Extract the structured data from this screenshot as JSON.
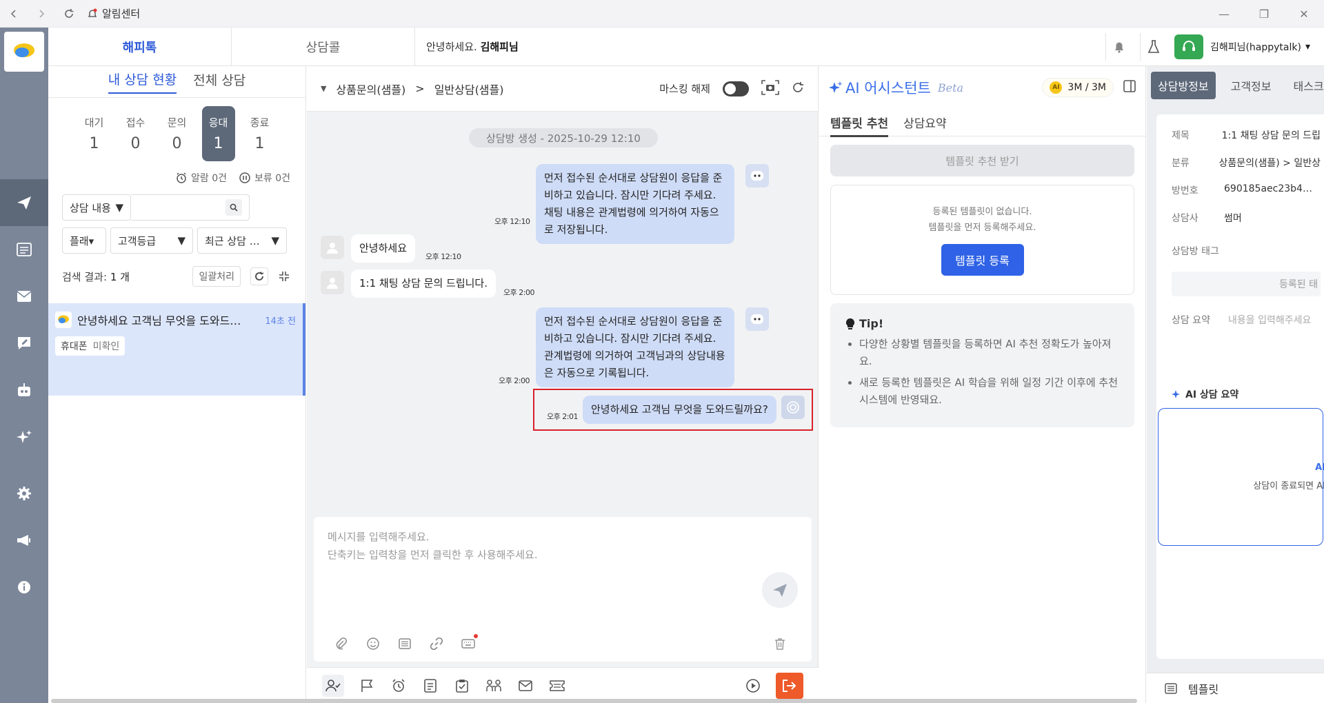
{
  "titlebar": {
    "title": "알림센터"
  },
  "header": {
    "tabs": [
      {
        "label": "해피톡",
        "active": true
      },
      {
        "label": "상담콜",
        "active": false
      }
    ],
    "greeting_prefix": "안녕하세요.",
    "greeting_name": "김해피님",
    "user": "김해피님(happytalk)"
  },
  "left": {
    "tabs": [
      {
        "label": "내 상담 현황",
        "active": true
      },
      {
        "label": "전체 상담",
        "active": false
      }
    ],
    "stats": [
      {
        "label": "대기",
        "value": "1"
      },
      {
        "label": "접수",
        "value": "0"
      },
      {
        "label": "문의",
        "value": "0"
      },
      {
        "label": "응대",
        "value": "1",
        "active": true
      },
      {
        "label": "종료",
        "value": "1"
      }
    ],
    "alarm": "알람 0건",
    "hold": "보류 0건",
    "filter": {
      "type": "상담 내용",
      "search_value": "",
      "platform": "플래▾",
      "grade": "고객등급",
      "sort": "최근 상담 …"
    },
    "result_prefix": "검색 결과:",
    "result_count": "1 개",
    "bulk": "일괄처리",
    "conversation": {
      "text": "안녕하세요 고객님 무엇을 도와드…",
      "time": "14초 전",
      "tag1": "휴대폰",
      "tag2": "미확인"
    }
  },
  "chat": {
    "breadcrumb": [
      "상품문의(샘플)",
      ">",
      "일반상담(샘플)"
    ],
    "masking": "마스킹 해제",
    "created": "상담방 생성 - 2025-10-29 12:10",
    "messages": [
      {
        "from": "agent",
        "text": "먼저 접수된 순서대로 상담원이 응답을 준비하고 있습니다. 잠시만 기다려 주세요. 채팅 내용은 관계법령에 의거하여 자동으로 저장됩니다.",
        "time": "오후 12:10"
      },
      {
        "from": "customer",
        "text": "안녕하세요",
        "time": "오후 12:10"
      },
      {
        "from": "customer",
        "text": "1:1 채팅 상담 문의 드립니다.",
        "time": "오후 2:00"
      },
      {
        "from": "agent",
        "text": "먼저 접수된 순서대로 상담원이 응답을 준비하고 있습니다. 잠시만 기다려 주세요. 관계법령에 의거하여 고객님과의 상담내용은 자동으로 기록됩니다.",
        "time": "오후 2:00"
      },
      {
        "from": "agent",
        "text": "안녕하세요 고객님 무엇을 도와드릴까요?",
        "time": "오후 2:01"
      }
    ],
    "composer_placeholder_1": "메시지를 입력해주세요.",
    "composer_placeholder_2": "단축키는 입력창을 먼저 클릭한 후 사용해주세요."
  },
  "ai": {
    "title": "AI 어시스턴트",
    "beta": "Beta",
    "quota": "3M / 3M",
    "tabs": [
      {
        "label": "템플릿 추천",
        "active": true
      },
      {
        "label": "상담요약",
        "active": false
      }
    ],
    "recommend_button": "템플릿 추천 받기",
    "empty_line1": "등록된 템플릿이 없습니다.",
    "empty_line2": "템플릿을 먼저 등록해주세요.",
    "register_button": "템플릿 등록",
    "tip_title": "Tip!",
    "tips": [
      "다양한 상황별 템플릿을 등록하면 AI 추천 정확도가 높아져요.",
      "새로 등록한 템플릿은 AI 학습을 위해 일정 기간 이후에 추천 시스템에 반영돼요."
    ]
  },
  "info": {
    "tabs": [
      {
        "label": "상담방정보",
        "active": true
      },
      {
        "label": "고객정보"
      },
      {
        "label": "태스크"
      }
    ],
    "rows": [
      {
        "k": "제목",
        "v": "1:1 채팅 상담 문의 드립"
      },
      {
        "k": "분류",
        "v": "상품문의(샘플) > 일반상"
      },
      {
        "k": "방번호",
        "v": "690185aec23b4…"
      },
      {
        "k": "상담사",
        "v": "썸머"
      }
    ],
    "tag_label": "상담방 태그",
    "tag_placeholder": "등록된 태",
    "summary_label": "상담 요약",
    "summary_placeholder": "내용을 입력해주세요",
    "ai_summary_title": "AI 상담 요약",
    "ai_summary_inner": "AI",
    "ai_summary_text": "상담이 종료되면 AI",
    "footer": "템플릿"
  }
}
